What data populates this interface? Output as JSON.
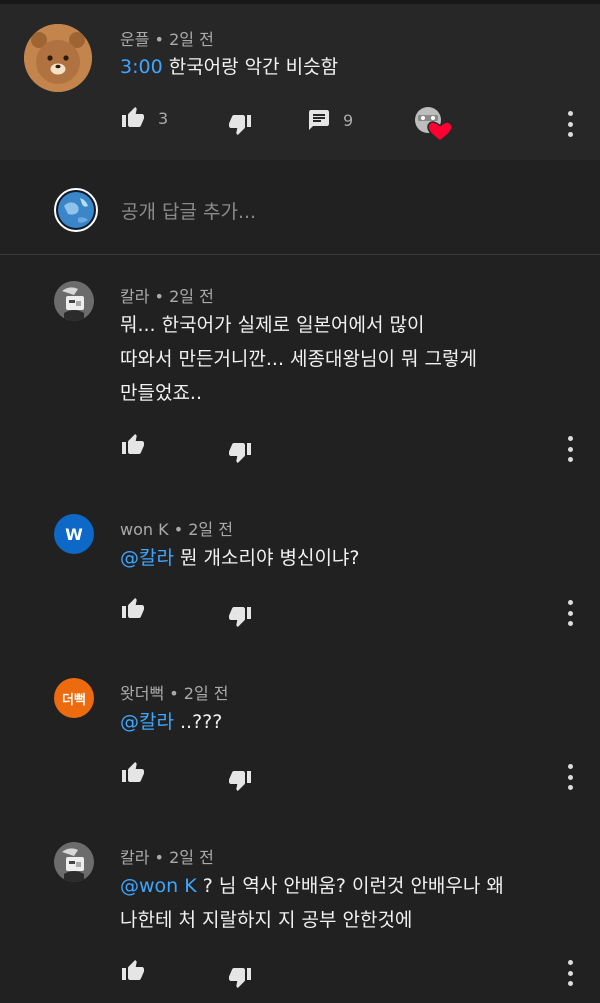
{
  "top_comment": {
    "author": "운플",
    "age": "2일 전",
    "timestamp_link": "3:00",
    "text": "한국어랑 악간 비슷함",
    "likes": "3",
    "replies": "9"
  },
  "reply_input": {
    "placeholder": "공개 답글 추가..."
  },
  "separator": "•",
  "replies": [
    {
      "author": "칼라",
      "age": "2일 전",
      "mention": "",
      "lines": [
        "뭐... 한국어가 실제로 일본어에서 많이",
        "따와서 만든거니깐... 세종대왕님이 뭐 그렇게",
        "만들었죠.."
      ]
    },
    {
      "author": "won K",
      "age": "2일 전",
      "avatar_letter": "W",
      "avatar_color": "#0d68c7",
      "mention": "@칼라",
      "lines": [
        " 뭔 개소리야 병신이냐?"
      ]
    },
    {
      "author": "왓더뻑",
      "age": "2일 전",
      "avatar_letter": "더뻑",
      "avatar_color": "#ee6a0e",
      "mention": "@칼라",
      "lines": [
        " ..???"
      ]
    },
    {
      "author": "칼라",
      "age": "2일 전",
      "mention": "@won K",
      "lines": [
        " ? 님 역사 안배움? 이런것 안배우나 왜",
        "나한테 처 지랄하지 지 공부 안한것에"
      ]
    }
  ],
  "colors": {
    "background": "#212121",
    "top_comment_bg": "#272727",
    "link": "#3ea6ff",
    "heart": "#ff0033"
  }
}
